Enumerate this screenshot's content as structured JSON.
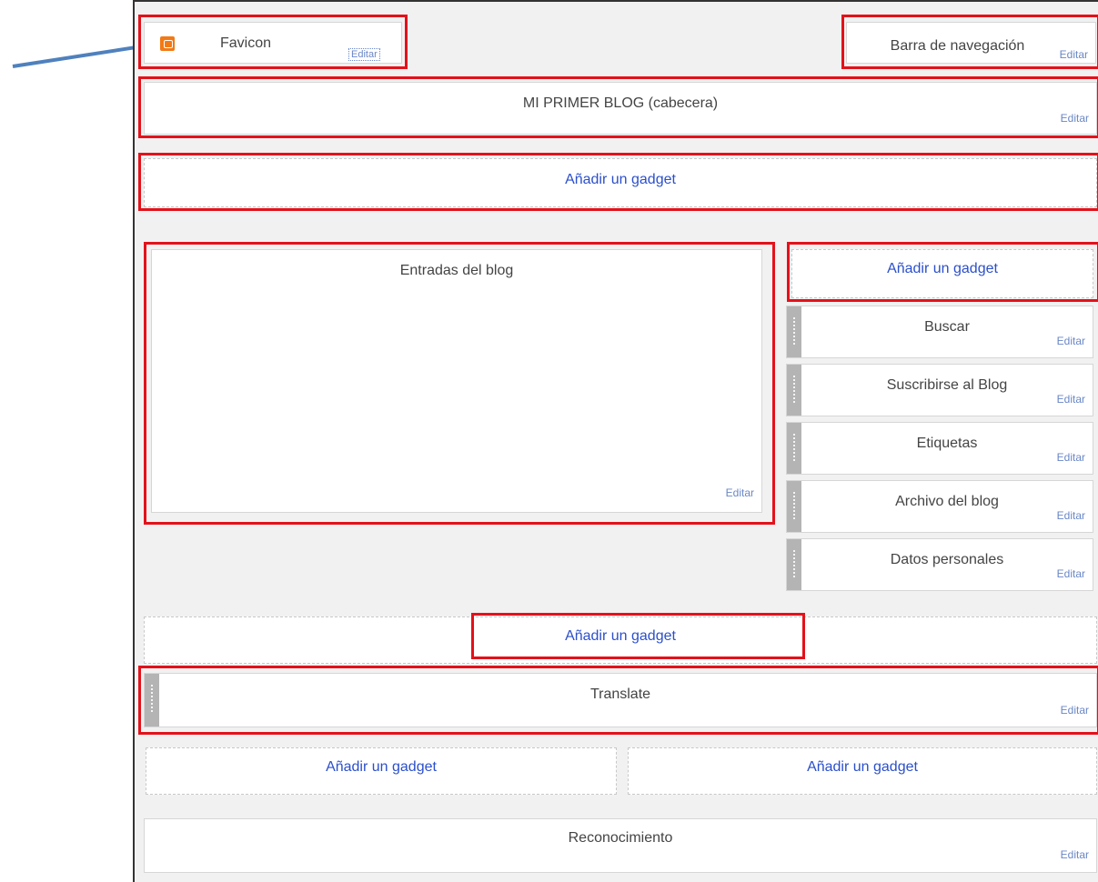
{
  "header": {
    "favicon": {
      "title": "Favicon",
      "edit": "Editar"
    },
    "navbar": {
      "title": "Barra de navegación",
      "edit": "Editar"
    },
    "blog_header": {
      "title": "MI PRIMER BLOG (cabecera)",
      "edit": "Editar"
    }
  },
  "add_gadget_label": "Añadir un gadget",
  "main": {
    "posts": {
      "title": "Entradas del blog",
      "edit": "Editar"
    }
  },
  "sidebar": {
    "add_label": "Añadir un gadget",
    "gadgets": [
      {
        "title": "Buscar",
        "edit": "Editar"
      },
      {
        "title": "Suscribirse al Blog",
        "edit": "Editar"
      },
      {
        "title": "Etiquetas",
        "edit": "Editar"
      },
      {
        "title": "Archivo del blog",
        "edit": "Editar"
      },
      {
        "title": "Datos personales",
        "edit": "Editar"
      }
    ]
  },
  "footer": {
    "add_label": "Añadir un gadget",
    "translate": {
      "title": "Translate",
      "edit": "Editar"
    },
    "add_left": "Añadir un gadget",
    "add_right": "Añadir un gadget",
    "attribution": {
      "title": "Reconocimiento",
      "edit": "Editar"
    }
  },
  "colors": {
    "highlight": "#e4111a",
    "link": "#2b4fcb",
    "edit": "#6a87c7",
    "arrow": "#4f81bd",
    "favicon": "#f27a14"
  }
}
